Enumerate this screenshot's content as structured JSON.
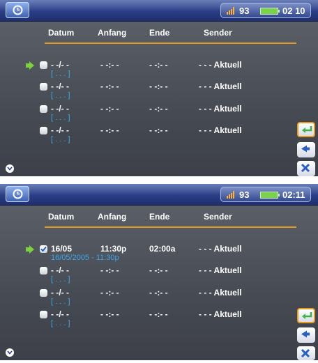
{
  "screens": [
    {
      "topbar": {
        "volume": "93",
        "time": "02 10"
      },
      "columns": [
        "Datum",
        "Anfang",
        "Ende",
        "Sender"
      ],
      "rows": [
        {
          "date": "- -/- -",
          "start": "- -:- -",
          "end": "- -:- -",
          "sender": "- - - Aktuell",
          "detail": "[ . . . ]",
          "selected": true,
          "checked": false
        },
        {
          "date": "- -/- -",
          "start": "- -:- -",
          "end": "- -:- -",
          "sender": "- - - Aktuell",
          "detail": "[ . . . ]",
          "selected": false,
          "checked": false
        },
        {
          "date": "- -/- -",
          "start": "- -:- -",
          "end": "- -:- -",
          "sender": "- - - Aktuell",
          "detail": "[ . . . ]",
          "selected": false,
          "checked": false
        },
        {
          "date": "- -/- -",
          "start": "- -:- -",
          "end": "- -:- -",
          "sender": "- - - Aktuell",
          "detail": "[ . . . ]",
          "selected": false,
          "checked": false
        }
      ]
    },
    {
      "topbar": {
        "volume": "93",
        "time": "02:11"
      },
      "columns": [
        "Datum",
        "Anfang",
        "Ende",
        "Sender"
      ],
      "rows": [
        {
          "date": "16/05",
          "start": "11:30p",
          "end": "02:00a",
          "sender": "- - - Aktuell",
          "detail": "16/05/2005 - 11:30p",
          "selected": true,
          "checked": true
        },
        {
          "date": "- -/- -",
          "start": "- -:- -",
          "end": "- -:- -",
          "sender": "- - - Aktuell",
          "detail": "[ . . . ]",
          "selected": false,
          "checked": false
        },
        {
          "date": "- -/- -",
          "start": "- -:- -",
          "end": "- -:- -",
          "sender": "- - - Aktuell",
          "detail": "[ . . . ]",
          "selected": false,
          "checked": false
        },
        {
          "date": "- -/- -",
          "start": "- -:- -",
          "end": "- -:- -",
          "sender": "- - - Aktuell",
          "detail": "[ . . . ]",
          "selected": false,
          "checked": false
        }
      ]
    }
  ],
  "icons": {
    "app": "clock-icon",
    "volume": "speaker-icon",
    "battery": "battery-icon",
    "select_arrow": "arrow-right-icon",
    "checkbox": "checkbox-icon",
    "side_buttons": [
      "enter-icon",
      "back-icon",
      "close-icon"
    ],
    "scroll": "chevron-down-icon"
  },
  "colors": {
    "accent": "#e59b1f",
    "detail_text": "#3aa8ea",
    "bar": "#2b3e86",
    "battery": "#7ad14c"
  }
}
